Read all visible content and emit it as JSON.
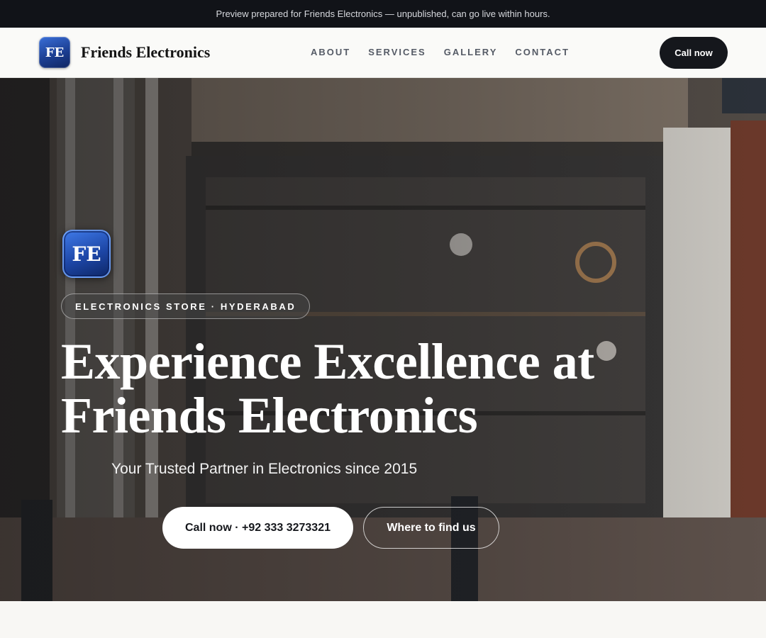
{
  "preview_bar": {
    "text": "Preview prepared for Friends Electronics — unpublished, can go live within hours."
  },
  "header": {
    "logo_initials": "FE",
    "brand_name": "Friends Electronics",
    "nav": [
      "ABOUT",
      "SERVICES",
      "GALLERY",
      "CONTACT"
    ],
    "cta_label": "Call now"
  },
  "hero": {
    "logo_initials": "FE",
    "pill": "ELECTRONICS STORE · HYDERABAD",
    "title_line1": "Experience Excellence at",
    "title_line2": "Friends Electronics",
    "subtitle": "Your Trusted Partner in Electronics since 2015",
    "primary_button": "Call now · +92 333 3273321",
    "secondary_button": "Where to find us",
    "background_image": "electronics-shop-storefront-photo"
  },
  "colors": {
    "dark": "#111318",
    "brand_blue": "#1c3f93",
    "page_bg": "#f8f7f4"
  }
}
